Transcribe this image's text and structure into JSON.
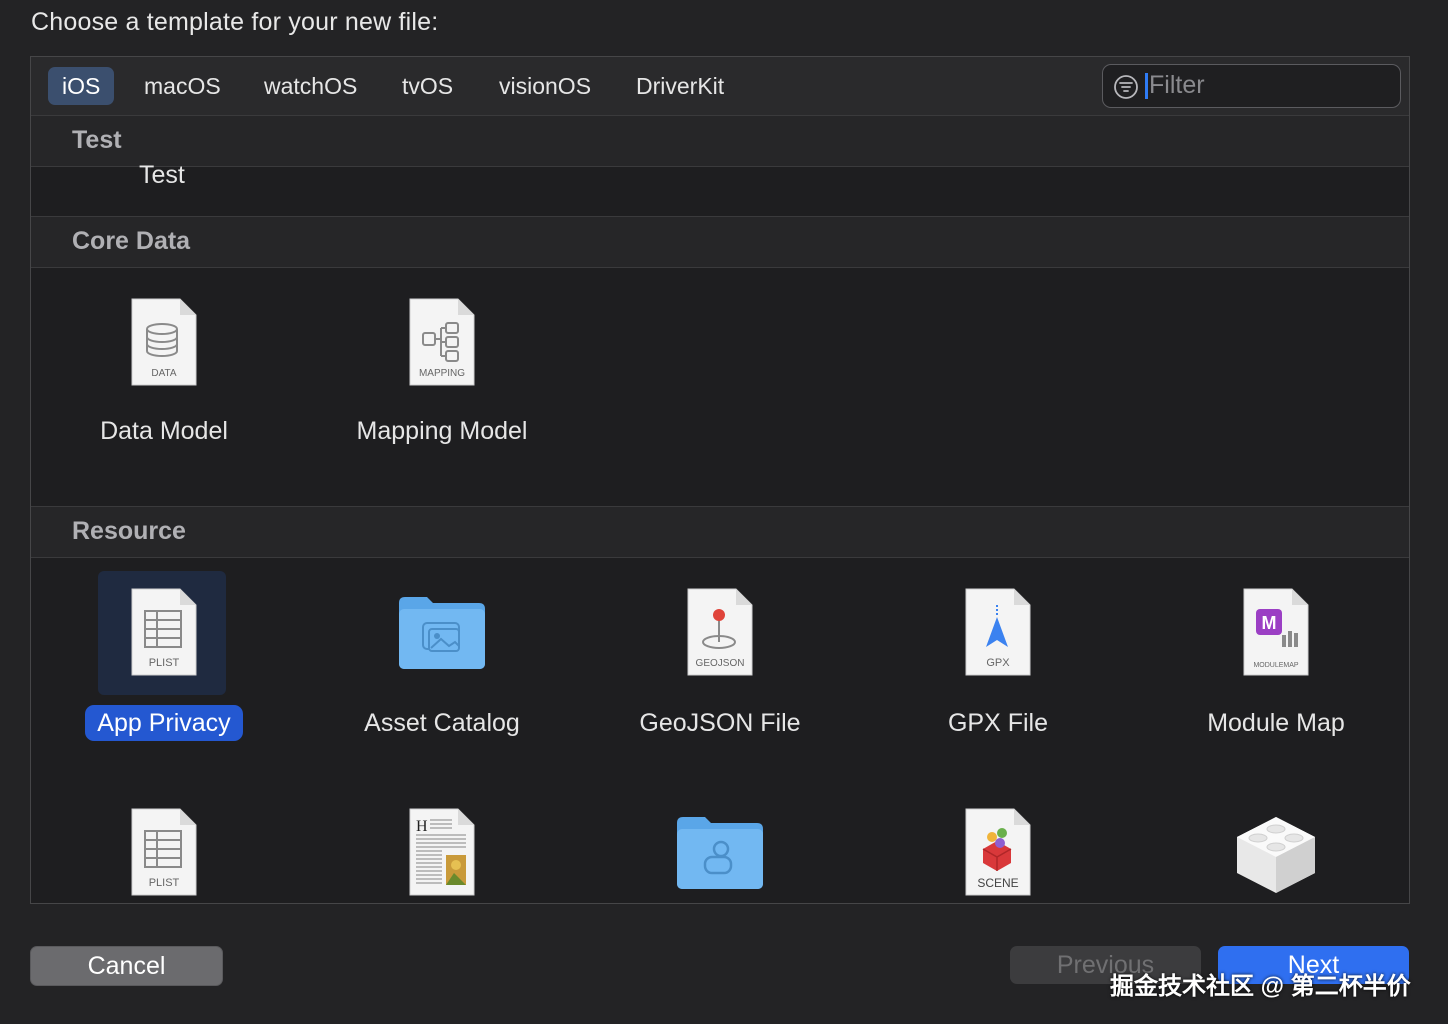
{
  "dialog": {
    "title": "Choose a template for your new file:"
  },
  "tabs": [
    {
      "label": "iOS",
      "selected": true
    },
    {
      "label": "macOS"
    },
    {
      "label": "watchOS"
    },
    {
      "label": "tvOS"
    },
    {
      "label": "visionOS"
    },
    {
      "label": "DriverKit"
    }
  ],
  "filter": {
    "placeholder": "Filter",
    "value": ""
  },
  "sections": {
    "test": {
      "title": "Test",
      "items": [
        "Test"
      ]
    },
    "core_data": {
      "title": "Core Data",
      "items": [
        {
          "label": "Data Model",
          "badge": "DATA",
          "icon": "database-document-icon"
        },
        {
          "label": "Mapping Model",
          "badge": "MAPPING",
          "icon": "mapping-document-icon"
        }
      ]
    },
    "resource": {
      "title": "Resource",
      "items": [
        {
          "label": "App Privacy",
          "badge": "PLIST",
          "icon": "plist-document-icon",
          "selected": true
        },
        {
          "label": "Asset Catalog",
          "icon": "asset-folder-icon"
        },
        {
          "label": "GeoJSON File",
          "badge": "GEOJSON",
          "icon": "geojson-document-icon"
        },
        {
          "label": "GPX File",
          "badge": "GPX",
          "icon": "gpx-document-icon"
        },
        {
          "label": "Module Map",
          "badge": "MODULEMAP",
          "icon": "modulemap-document-icon"
        }
      ],
      "row2": [
        {
          "badge": "PLIST",
          "icon": "plist-document-icon"
        },
        {
          "icon": "rich-text-document-icon"
        },
        {
          "icon": "folder-icon"
        },
        {
          "badge": "SCENE",
          "icon": "scene-document-icon"
        },
        {
          "icon": "lego-brick-icon"
        }
      ]
    }
  },
  "buttons": {
    "cancel": "Cancel",
    "previous": "Previous",
    "next": "Next"
  },
  "watermark": "掘金技术社区 @ 第二杯半价",
  "colors": {
    "accent": "#2f6ff0",
    "selection": "#2458d1",
    "background": "#232325"
  }
}
